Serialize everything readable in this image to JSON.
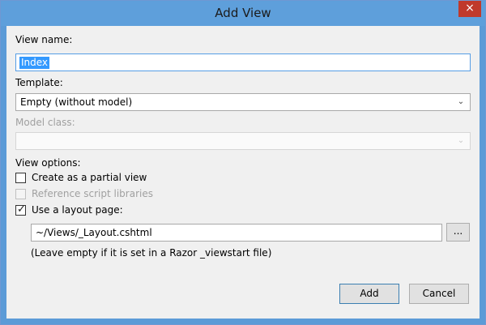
{
  "window": {
    "title": "Add View",
    "close_glyph": "×"
  },
  "form": {
    "view_name": {
      "label": "View name:",
      "value": "Index"
    },
    "template": {
      "label": "Template:",
      "selected": "Empty (without model)"
    },
    "model_class": {
      "label": "Model class:",
      "selected": ""
    },
    "view_options_label": "View options:",
    "options": [
      {
        "label": "Create as a partial view",
        "checked": false,
        "enabled": true
      },
      {
        "label": "Reference script libraries",
        "checked": false,
        "enabled": false
      },
      {
        "label": "Use a layout page:",
        "checked": true,
        "enabled": true
      }
    ],
    "layout_path": "~/Views/_Layout.cshtml",
    "browse_label": "...",
    "hint": "(Leave empty if it is set in a Razor _viewstart file)"
  },
  "buttons": {
    "add": "Add",
    "cancel": "Cancel"
  },
  "icons": {
    "dropdown": "chevron-down-icon",
    "checkmark": "checkmark-icon",
    "close": "close-icon"
  }
}
